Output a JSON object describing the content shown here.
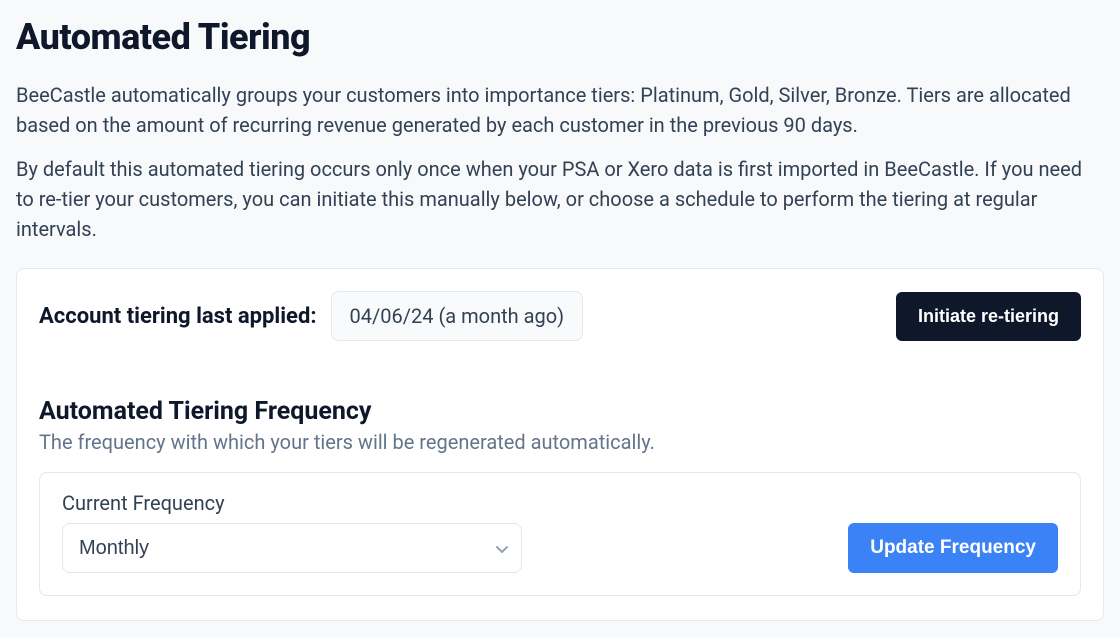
{
  "page": {
    "title": "Automated Tiering",
    "paragraph1": "BeeCastle automatically groups your customers into importance tiers: Platinum, Gold, Silver, Bronze. Tiers are allocated based on the amount of recurring revenue generated by each customer in the previous 90 days.",
    "paragraph2": "By default this automated tiering occurs only once when your PSA or Xero data is first imported in BeeCastle. If you need to re-tier your customers, you can initiate this manually below, or choose a schedule to perform the tiering at regular intervals."
  },
  "tiering": {
    "last_applied_label": "Account tiering last applied:",
    "last_applied_value": "04/06/24 (a month ago)",
    "initiate_button": "Initiate re-tiering"
  },
  "frequency": {
    "title": "Automated Tiering Frequency",
    "subtitle": "The frequency with which your tiers will be regenerated automatically.",
    "label": "Current Frequency",
    "selected": "Monthly",
    "update_button": "Update Frequency"
  }
}
